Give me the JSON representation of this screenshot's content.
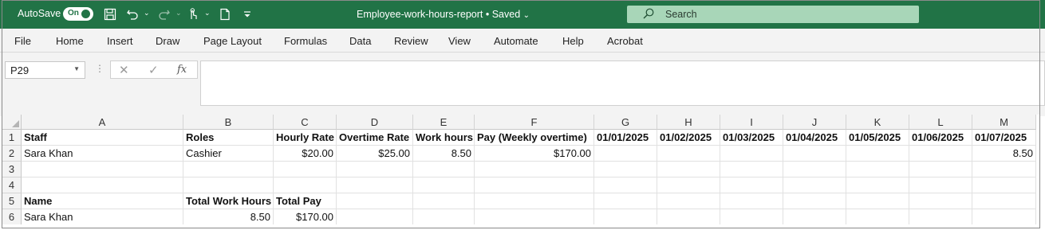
{
  "titlebar": {
    "autosave_label": "AutoSave",
    "autosave_state": "On",
    "doc_title": "Employee-work-hours-report • Saved",
    "search_placeholder": "Search",
    "accent_color": "#217346"
  },
  "ribbon": {
    "tabs": [
      "File",
      "Home",
      "Insert",
      "Draw",
      "Page Layout",
      "Formulas",
      "Data",
      "Review",
      "View",
      "Automate",
      "Help",
      "Acrobat"
    ]
  },
  "formula_bar": {
    "name_box": "P29",
    "cancel_symbol": "✕",
    "enter_symbol": "✓",
    "fx_symbol": "fx",
    "formula": ""
  },
  "sheet": {
    "columns": [
      "A",
      "B",
      "C",
      "D",
      "E",
      "F",
      "G",
      "H",
      "I",
      "J",
      "K",
      "L",
      "M"
    ],
    "rows": [
      "1",
      "2",
      "3",
      "4",
      "5",
      "6"
    ],
    "r1": {
      "A": "Staff",
      "B": "Roles",
      "C": "Hourly Rate",
      "D": "Overtime Rate",
      "E": "Work hours",
      "F": "Pay (Weekly overtime)",
      "G": "01/01/2025",
      "H": "01/02/2025",
      "I": "01/03/2025",
      "J": "01/04/2025",
      "K": "01/05/2025",
      "L": "01/06/2025",
      "M": "01/07/2025"
    },
    "r2": {
      "A": "Sara Khan",
      "B": "Cashier",
      "C": "$20.00",
      "D": "$25.00",
      "E": "8.50",
      "F": "$170.00",
      "M": "8.50"
    },
    "r5": {
      "A": "Name",
      "B": "Total Work Hours",
      "C": "Total Pay"
    },
    "r6": {
      "A": "Sara Khan",
      "B": "8.50",
      "C": "$170.00"
    }
  }
}
